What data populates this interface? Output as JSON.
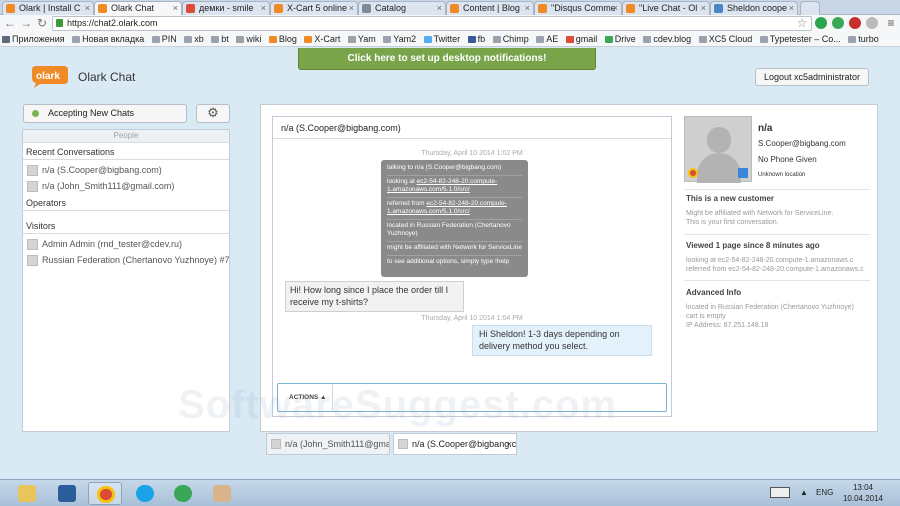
{
  "browser": {
    "tabs": [
      {
        "label": "Olark | Install C",
        "color": "#f08a24"
      },
      {
        "label": "Olark Chat",
        "color": "#f08a24"
      },
      {
        "label": "демки - smile",
        "color": "#dd4b39"
      },
      {
        "label": "X-Cart 5 online",
        "color": "#f08a24"
      },
      {
        "label": "Catalog",
        "color": "#7d8b99"
      },
      {
        "label": "Content | Blog",
        "color": "#f08a24"
      },
      {
        "label": "\"Disqus Comme",
        "color": "#f08a24"
      },
      {
        "label": "\"Live Chat - Ol",
        "color": "#f08a24"
      },
      {
        "label": "Sheldon coope",
        "color": "#4a86c5"
      }
    ],
    "url": "https://chat2.olark.com",
    "bookmarks": [
      {
        "label": "Приложения",
        "color": "#5b6b7b"
      },
      {
        "label": "Новая вкладка",
        "color": "#9aa3ad"
      },
      {
        "label": "PIN",
        "color": "#9aa3ad"
      },
      {
        "label": "xb",
        "color": "#9aa3ad"
      },
      {
        "label": "bt",
        "color": "#9aa3ad"
      },
      {
        "label": "wiki",
        "color": "#9aa3ad"
      },
      {
        "label": "Blog",
        "color": "#f08a24"
      },
      {
        "label": "X-Cart",
        "color": "#f08a24"
      },
      {
        "label": "Yam",
        "color": "#9aa3ad"
      },
      {
        "label": "Yam2",
        "color": "#9aa3ad"
      },
      {
        "label": "Twitter",
        "color": "#55acee"
      },
      {
        "label": "fb",
        "color": "#3b5998"
      },
      {
        "label": "Chimp",
        "color": "#9aa3ad"
      },
      {
        "label": "AE",
        "color": "#9aa3ad"
      },
      {
        "label": "gmail",
        "color": "#dd4b39"
      },
      {
        "label": "Drive",
        "color": "#3aa757"
      },
      {
        "label": "cdev.blog",
        "color": "#9aa3ad"
      },
      {
        "label": "XC5 Cloud",
        "color": "#9aa3ad"
      },
      {
        "label": "Typetester – Co...",
        "color": "#9aa3ad"
      },
      {
        "label": "turbo",
        "color": "#9aa3ad"
      }
    ]
  },
  "header": {
    "logo_text": "olark",
    "app_name": "Olark Chat",
    "notification": "Click here to set up desktop notifications!",
    "logout": "Logout xc5administrator"
  },
  "sidebar": {
    "status": "Accepting New Chats",
    "people_header": "People",
    "recent_title": "Recent Conversations",
    "recent": [
      "n/a (S.Cooper@bigbang.com)",
      "n/a (John_Smith111@gmail.com)"
    ],
    "operators_title": "Operators",
    "visitors_title": "Visitors",
    "visitors": [
      "Admin Admin (rnd_tester@cdev.ru)",
      "Russian Federation (Chertanovo Yuzhnoye) #7435"
    ]
  },
  "chat": {
    "title": "n/a (S.Cooper@bigbang.com)",
    "timestamp1": "Thursday, April 10 2014 1:02 PM",
    "info": {
      "talking": "talking to n/a (S.Cooper@bigbang.com)",
      "looking_prefix": "looking at ",
      "looking_link": "ec2-54-82-248-20.compute-1.amazonaws.com/5.1.0/src/",
      "referred_prefix": "referred from ",
      "referred_link": "ec2-54-82-248-20.compute-1.amazonaws.com/5.1.0/src/",
      "located": "located in Russian Federation (Chertanovo Yuzhnoye)",
      "affiliated": "might be affiliated with Network for ServiceLine",
      "help": "to see additional options, simply type !help"
    },
    "msg_in": "Hi! How long since I place the order till I receive my t-shirts?",
    "timestamp2": "Thursday, April 10 2014 1:04 PM",
    "msg_out": "Hi Sheldon! 1-3 days depending on delivery method you select.",
    "actions": "ACTIONS ▲"
  },
  "profile": {
    "name": "n/a",
    "email": "S.Cooper@bigbang.com",
    "phone": "No Phone Given",
    "location": "Unknown location",
    "new_customer_title": "This is a new customer",
    "new_customer_line1": "Might be affiliated with Network for ServiceLine.",
    "new_customer_line2": "This is your first conversation.",
    "viewed_title": "Viewed 1 page since 8 minutes ago",
    "viewed_line1": "looking at ec2-54-82-248-20.compute-1.amazonaws.c",
    "viewed_line2": "referred from ec2-54-82-248-20.compute-1.amazonaws.c",
    "advanced_title": "Advanced Info",
    "adv1": "located in Russian Federation (Chertanovo Yuzhnoye)",
    "adv2": "cart is empty",
    "adv3": "IP Address: 87.251.148.18"
  },
  "bottom_tabs": [
    {
      "label": "n/a (John_Smith111@gma"
    },
    {
      "label": "n/a (S.Cooper@bigbang.c"
    }
  ],
  "watermark": "SoftwareSuggest.com",
  "taskbar": {
    "lang": "ENG",
    "time": "13:04",
    "date": "10.04.2014"
  }
}
